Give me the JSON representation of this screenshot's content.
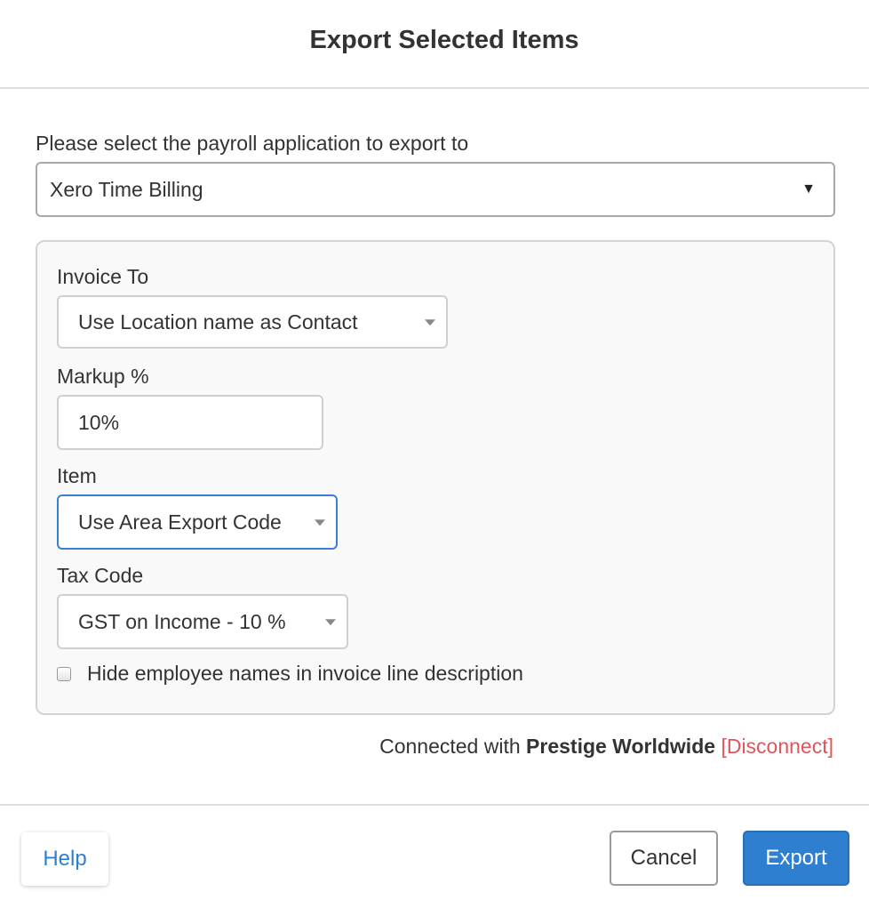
{
  "dialog": {
    "title": "Export Selected Items"
  },
  "app_select": {
    "label": "Please select the payroll application to export to",
    "value": "Xero Time Billing"
  },
  "options": {
    "invoice_to": {
      "label": "Invoice To",
      "value": "Use Location name as Contact"
    },
    "markup": {
      "label": "Markup %",
      "value": "10%"
    },
    "item": {
      "label": "Item",
      "value": "Use Area Export Code"
    },
    "tax_code": {
      "label": "Tax Code",
      "value": "GST on Income - 10 %"
    },
    "hide_names": {
      "label": "Hide employee names in invoice line description",
      "checked": false
    }
  },
  "connection": {
    "prefix": "Connected with",
    "company": "Prestige Worldwide",
    "disconnect_label": "[Disconnect]"
  },
  "footer": {
    "help_label": "Help",
    "cancel_label": "Cancel",
    "export_label": "Export"
  },
  "colors": {
    "primary": "#2f7fd1",
    "danger": "#e0555a",
    "focus": "#3a7fd5"
  },
  "icons": {
    "app_select_caret": "caret-down-solid-icon",
    "field_caret": "caret-down-icon"
  }
}
